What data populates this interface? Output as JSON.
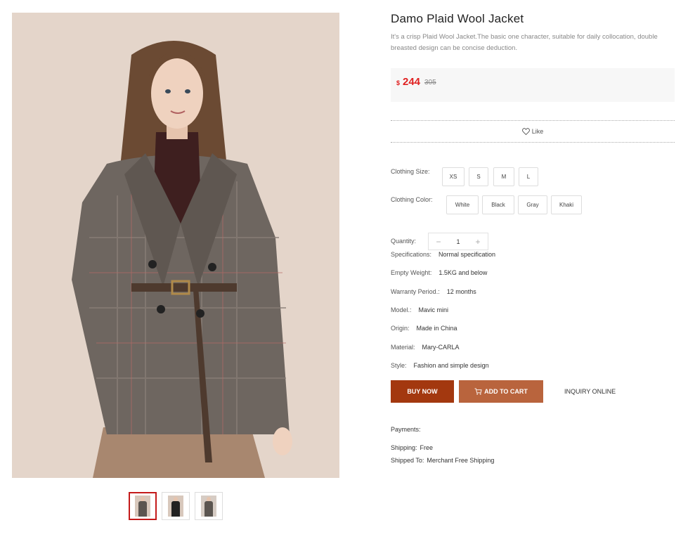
{
  "gallery": {
    "thumbnails": [
      {
        "name": "thumb-1",
        "active": true
      },
      {
        "name": "thumb-2",
        "active": false
      },
      {
        "name": "thumb-3",
        "active": false
      }
    ]
  },
  "product": {
    "title": "Damo Plaid Wool Jacket",
    "description": "It's a crisp Plaid Wool Jacket.The basic one character, suitable for daily collocation, double breasted design can be concise deduction.",
    "price": {
      "currency": "$",
      "current": "244",
      "original": "305",
      "color": "#e02020"
    },
    "like_label": "Like"
  },
  "options": {
    "size_label": "Clothing Size:",
    "sizes": [
      "XS",
      "S",
      "M",
      "L"
    ],
    "color_label": "Clothing Color:",
    "colors": [
      "White",
      "Black",
      "Gray",
      "Khaki"
    ],
    "quantity_label": "Quantity:",
    "quantity": "1",
    "minus": "−",
    "plus": "+"
  },
  "specs": [
    {
      "label": "Specifications:",
      "value": "Normal specification"
    },
    {
      "label": "Empty Weight:",
      "value": "1.5KG and below"
    },
    {
      "label": "Warranty Period.:",
      "value": "12 months"
    },
    {
      "label": "Model.:",
      "value": "Mavic mini"
    },
    {
      "label": "Origin:",
      "value": "Made in China"
    },
    {
      "label": "Material:",
      "value": "Mary-CARLA"
    },
    {
      "label": "Style:",
      "value": "Fashion and simple design"
    }
  ],
  "actions": {
    "buy_now": "BUY NOW",
    "add_to_cart": "ADD TO CART",
    "inquiry": "INQUIRY ONLINE",
    "buy_color": "#a3380f",
    "cart_color": "#b9643d"
  },
  "payment": {
    "payments_label": "Payments:",
    "shipping_label": "Shipping:",
    "shipping_value": "Free",
    "shipped_to_label": "Shipped To:",
    "shipped_to_value": "Merchant Free Shipping"
  }
}
